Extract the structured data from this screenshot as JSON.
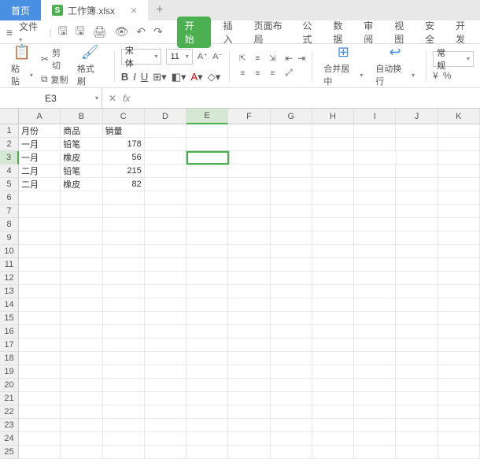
{
  "tabs": {
    "home": "首页",
    "file": "工作簿.xlsx"
  },
  "menu": {
    "file": "文件",
    "tabs": [
      "开始",
      "插入",
      "页面布局",
      "公式",
      "数据",
      "审阅",
      "视图",
      "安全",
      "开发"
    ]
  },
  "ribbon": {
    "paste": "粘贴",
    "cut": "剪切",
    "copy": "复制",
    "format_painter": "格式刷",
    "font_name": "宋体",
    "font_size": "11",
    "merge": "合并居中",
    "wrap": "自动换行",
    "format_general": "常规"
  },
  "name_box": "E3",
  "columns": [
    "A",
    "B",
    "C",
    "D",
    "E",
    "F",
    "G",
    "H",
    "I",
    "J",
    "K"
  ],
  "row_count": 25,
  "selected": {
    "row": 3,
    "col": "E"
  },
  "data": {
    "headers": [
      "月份",
      "商品",
      "销量"
    ],
    "rows": [
      [
        "一月",
        "铅笔",
        178
      ],
      [
        "一月",
        "橡皮",
        56
      ],
      [
        "二月",
        "铅笔",
        215
      ],
      [
        "二月",
        "橡皮",
        82
      ]
    ]
  }
}
